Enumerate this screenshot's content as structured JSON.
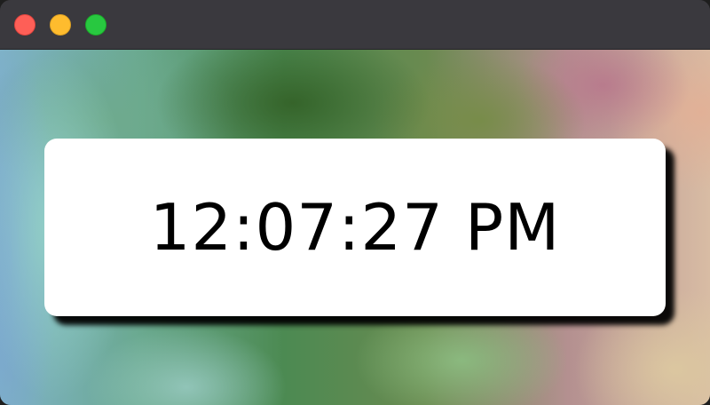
{
  "window": {
    "controls": [
      {
        "name": "close",
        "color": "#fe5f57"
      },
      {
        "name": "minimize",
        "color": "#febc2e"
      },
      {
        "name": "zoom",
        "color": "#28c840"
      }
    ]
  },
  "clock": {
    "time": "12:07:27 PM"
  }
}
